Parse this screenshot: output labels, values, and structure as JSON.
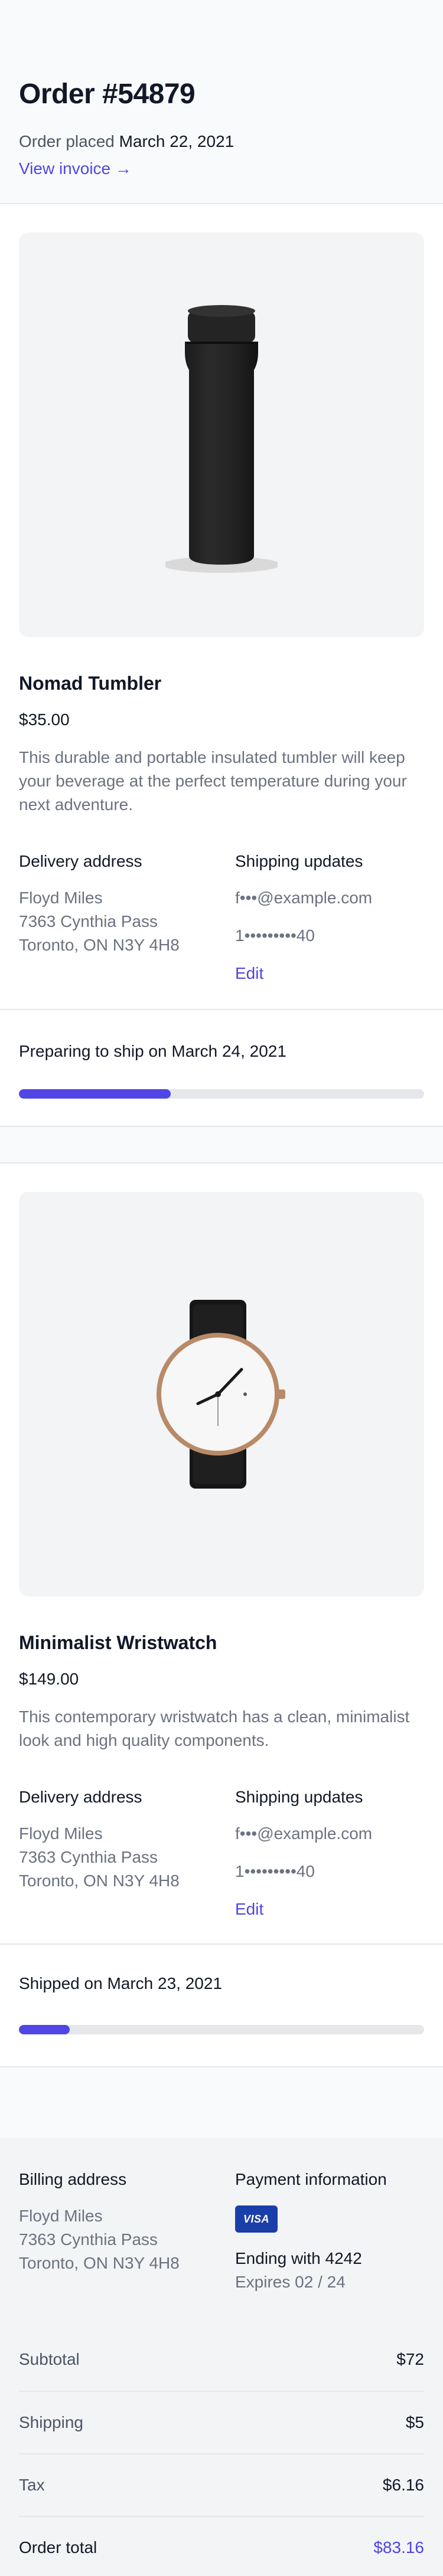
{
  "order": {
    "title": "Order #54879",
    "placed_label": "Order placed",
    "placed_date": "March 22, 2021",
    "view_invoice": "View invoice →"
  },
  "products": [
    {
      "name": "Nomad Tumbler",
      "price": "$35.00",
      "description": "This durable and portable insulated tumbler will keep your beverage at the perfect temperature during your next adventure.",
      "delivery_heading": "Delivery address",
      "address": [
        "Floyd Miles",
        "7363 Cynthia Pass",
        "Toronto, ON N3Y 4H8"
      ],
      "shipping_heading": "Shipping updates",
      "email": "f•••@example.com",
      "phone": "1•••••••••40",
      "edit_label": "Edit",
      "status": "Preparing to ship on March 24, 2021",
      "progress": 0.375,
      "image": "tumbler"
    },
    {
      "name": "Minimalist Wristwatch",
      "price": "$149.00",
      "description": "This contemporary wristwatch has a clean, minimalist look and high quality components.",
      "delivery_heading": "Delivery address",
      "address": [
        "Floyd Miles",
        "7363 Cynthia Pass",
        "Toronto, ON N3Y 4H8"
      ],
      "shipping_heading": "Shipping updates",
      "email": "f•••@example.com",
      "phone": "1•••••••••40",
      "edit_label": "Edit",
      "status": "Shipped on March 23, 2021",
      "progress": 0.125,
      "image": "wristwatch"
    }
  ],
  "billing": {
    "heading": "Billing address",
    "address": [
      "Floyd Miles",
      "7363 Cynthia Pass",
      "Toronto, ON N3Y 4H8"
    ]
  },
  "payment": {
    "heading": "Payment information",
    "card_brand": "VISA",
    "ending": "Ending with 4242",
    "expires": "Expires 02 / 24"
  },
  "totals": [
    {
      "label": "Subtotal",
      "value": "$72"
    },
    {
      "label": "Shipping",
      "value": "$5"
    },
    {
      "label": "Tax",
      "value": "$6.16"
    },
    {
      "label": "Order total",
      "value": "$83.16"
    }
  ],
  "colors": {
    "accent": "#4f46e5",
    "track": "#e5e7eb",
    "visa": "#1a3fa8"
  }
}
